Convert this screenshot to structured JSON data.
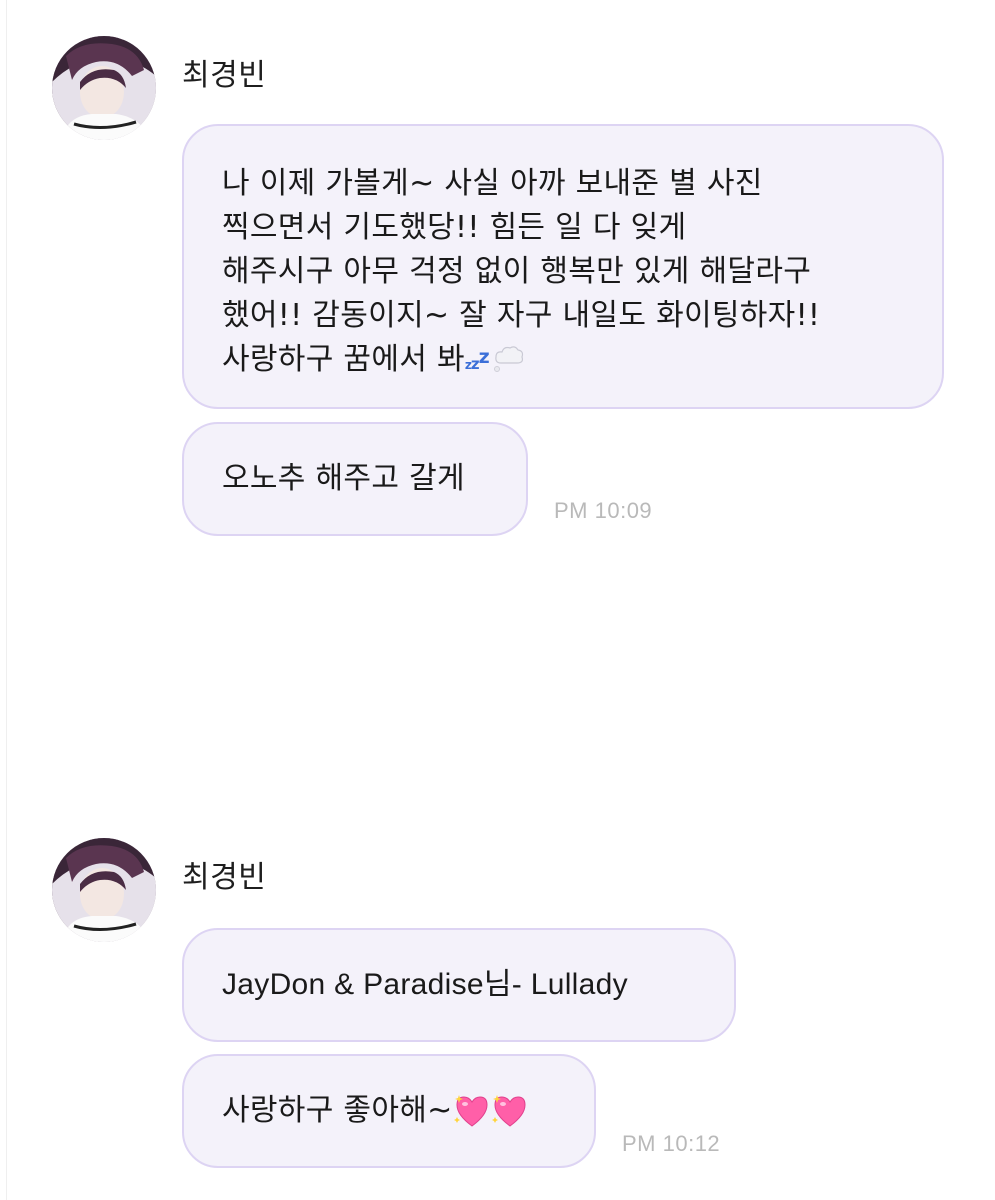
{
  "groups": [
    {
      "sender": {
        "name": "최경빈",
        "avatar": "profile-photo"
      },
      "messages": [
        {
          "lines": [
            "나 이제 가볼게~ 사실 아까 보내준 별 사진",
            "찍으면서 기도했당!!              힘든 일 다 잊게",
            "해주시구 아무 걱정 없이 행복만 있게 해달라구",
            "했어!! 감동이지~ 잘 자구 내일도 화이팅하자!!",
            "사랑하구 꿈에서 봐"
          ],
          "trailing_emoji": [
            "zzz-icon",
            "thought-bubble-icon"
          ]
        },
        {
          "text": "오노추 해주고 갈게",
          "time": "PM 10:09"
        }
      ]
    },
    {
      "sender": {
        "name": "최경빈",
        "avatar": "profile-photo"
      },
      "messages": [
        {
          "text": "JayDon & Paradise님- Lullady"
        },
        {
          "text": "사랑하구 좋아해~",
          "trailing_emoji": [
            "sparkling-heart-icon",
            "sparkling-heart-icon"
          ],
          "time": "PM 10:12"
        }
      ]
    }
  ],
  "colors": {
    "bubble_bg": "#f4f2fa",
    "bubble_border": "#ddd4f3",
    "timestamp": "#b9b9b9",
    "heart": "#ff5fa8"
  }
}
